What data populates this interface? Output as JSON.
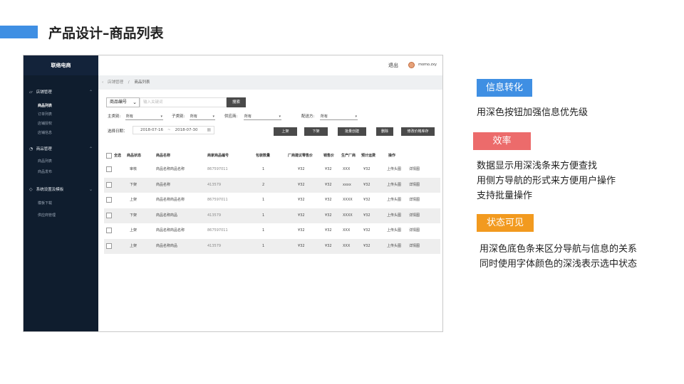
{
  "slide": {
    "title": "产品设计–商品列表"
  },
  "sidebar": {
    "brand": "联络电商",
    "groups": [
      {
        "label": "店铺管理",
        "items": [
          "商品列表",
          "订单列表",
          "店铺授权",
          "店铺信息"
        ]
      },
      {
        "label": "商品管理",
        "items": [
          "商品列表",
          "商品发布"
        ]
      },
      {
        "label": "系统设置及模板",
        "items": [
          "模板下载",
          "供应商管理"
        ]
      }
    ]
  },
  "topbar": {
    "logout": "退出",
    "username": "momo.zxy"
  },
  "breadcrumb": {
    "parent": "店铺管理",
    "separator": "/",
    "current": "商品列表"
  },
  "search": {
    "field": "商品编号",
    "placeholder": "输入关键词",
    "button": "搜索"
  },
  "filters": {
    "main_category": {
      "label": "主类别:",
      "value": "所有"
    },
    "sub_category": {
      "label": "子类别:",
      "value": "所有"
    },
    "supplier": {
      "label": "供应商:",
      "value": "所有"
    },
    "shipper": {
      "label": "配送方:",
      "value": "所有"
    },
    "date": {
      "label": "选择日期：",
      "start": "2018-07-16",
      "tilde": "~",
      "end": "2018-07-30"
    }
  },
  "actions": [
    "上架",
    "下架",
    "批量创建",
    "删除",
    "修改价格库存"
  ],
  "table": {
    "headers": [
      "全选",
      "商品状态",
      "商品名称",
      "商家商品编号",
      "包装数量",
      "厂商建议零售价",
      "销售价",
      "生产厂商",
      "预计运费",
      "操作"
    ],
    "rows": [
      {
        "status": "审核",
        "name": "商品名称商品名称",
        "code": "867597011",
        "qty": "1",
        "msrp": "¥32",
        "price": "¥32",
        "maker": "XXX",
        "freight": "¥32",
        "op1": "上传头图",
        "op2": "详情图"
      },
      {
        "status": "下架",
        "name": "商品名称",
        "code": "413579",
        "qty": "2",
        "msrp": "¥32",
        "price": "¥32",
        "maker": "xxxx",
        "freight": "¥32",
        "op1": "上传头图",
        "op2": "详情图"
      },
      {
        "status": "上架",
        "name": "商品名称商品名称",
        "code": "867597011",
        "qty": "1",
        "msrp": "¥32",
        "price": "¥32",
        "maker": "XXXX",
        "freight": "¥32",
        "op1": "上传头图",
        "op2": "详情图"
      },
      {
        "status": "下架",
        "name": "商品名称商品",
        "code": "413579",
        "qty": "1",
        "msrp": "¥32",
        "price": "¥32",
        "maker": "XXXX",
        "freight": "¥32",
        "op1": "上传头图",
        "op2": "详情图"
      },
      {
        "status": "上架",
        "name": "商品名称商品名称",
        "code": "867597011",
        "qty": "1",
        "msrp": "¥32",
        "price": "¥32",
        "maker": "XXX",
        "freight": "¥32",
        "op1": "上传头图",
        "op2": "详情图"
      },
      {
        "status": "上架",
        "name": "商品名称商品",
        "code": "413579",
        "qty": "1",
        "msrp": "¥32",
        "price": "¥32",
        "maker": "XXX",
        "freight": "¥32",
        "op1": "上传头图",
        "op2": "详情图"
      }
    ]
  },
  "annotations": [
    {
      "tag": "信息转化",
      "color": "#3f8fe3",
      "lines": [
        "用深色按钮加强信息优先级"
      ]
    },
    {
      "tag": "效率",
      "color": "#ec6b6b",
      "lines": [
        "数据显示用深浅条来方便查找",
        "用侧方导航的形式来方便用户操作",
        "支持批量操作"
      ]
    },
    {
      "tag": "状态可见",
      "color": "#f29a1f",
      "lines": [
        "用深色底色条来区分导航与信息的关系",
        "同时使用字体颜色的深浅表示选中状态"
      ]
    }
  ]
}
